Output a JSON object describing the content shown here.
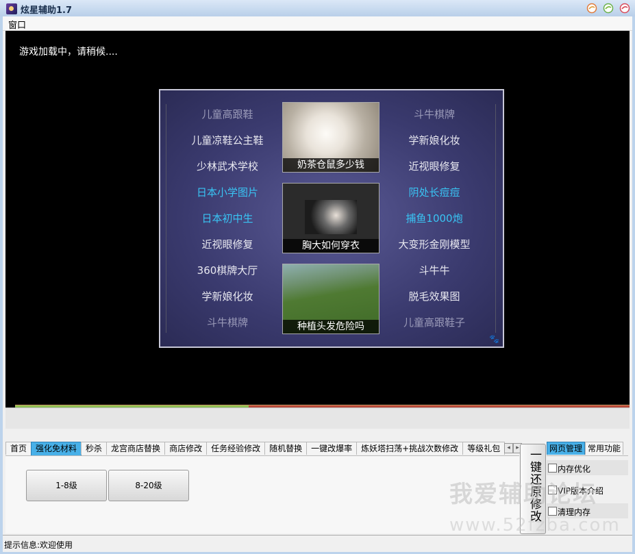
{
  "window": {
    "title": "炫星辅助1.7",
    "controls": [
      "minimize-icon",
      "maximize-icon",
      "close-icon"
    ]
  },
  "menubar": {
    "items": [
      "窗口"
    ]
  },
  "game": {
    "loading_text": "游戏加载中，请稍候....",
    "ad": {
      "left_links": [
        {
          "text": "儿童高跟鞋",
          "style": "dim"
        },
        {
          "text": "儿童凉鞋公主鞋",
          "style": "normal"
        },
        {
          "text": "少林武术学校",
          "style": "normal"
        },
        {
          "text": "日本小学图片",
          "style": "cyan"
        },
        {
          "text": "日本初中生",
          "style": "cyan"
        },
        {
          "text": "近视眼修复",
          "style": "normal"
        },
        {
          "text": "360棋牌大厅",
          "style": "normal"
        },
        {
          "text": "学新娘化妆",
          "style": "normal"
        },
        {
          "text": "斗牛棋牌",
          "style": "dim"
        }
      ],
      "right_links": [
        {
          "text": "斗牛棋牌",
          "style": "dim"
        },
        {
          "text": "学新娘化妆",
          "style": "normal"
        },
        {
          "text": "近视眼修复",
          "style": "normal"
        },
        {
          "text": "阴处长痘痘",
          "style": "cyan"
        },
        {
          "text": "捕鱼1000炮",
          "style": "cyan"
        },
        {
          "text": "大变形金刚模型",
          "style": "normal"
        },
        {
          "text": "斗牛牛",
          "style": "normal"
        },
        {
          "text": "脱毛效果图",
          "style": "normal"
        },
        {
          "text": "儿童高跟鞋子",
          "style": "dim"
        }
      ],
      "thumbnails": [
        {
          "caption": "奶茶仓鼠多少钱"
        },
        {
          "caption": "胸大如何穿衣"
        },
        {
          "caption": "种植头发危险吗"
        }
      ],
      "badge_icon": "paw-icon"
    },
    "load_progress_percent": 38
  },
  "tabs": {
    "items": [
      "首页",
      "强化免材料",
      "秒杀",
      "龙宫商店替换",
      "商店修改",
      "任务经验修改",
      "随机替换",
      "一键改爆率",
      "炼妖塔扫荡+挑战次数修改",
      "等级礼包"
    ],
    "active_index": 1,
    "scroll_left": "◂",
    "scroll_right": "▸"
  },
  "panel": {
    "buttons": [
      "1-8级",
      "8-20级"
    ]
  },
  "restore_button": {
    "label": "一键还原修改"
  },
  "right_panel": {
    "tabs": [
      "网页管理",
      "常用功能"
    ],
    "active_index": 0,
    "checkboxes": [
      {
        "label": "内存优化",
        "checked": false
      },
      {
        "label": "VIP版本介绍",
        "checked": false
      },
      {
        "label": "清理内存",
        "checked": false
      }
    ]
  },
  "watermark": {
    "line1": "我爱辅助论坛",
    "line2": "www.52fzba.com"
  },
  "status_bar": {
    "text": "提示信息:欢迎使用"
  }
}
